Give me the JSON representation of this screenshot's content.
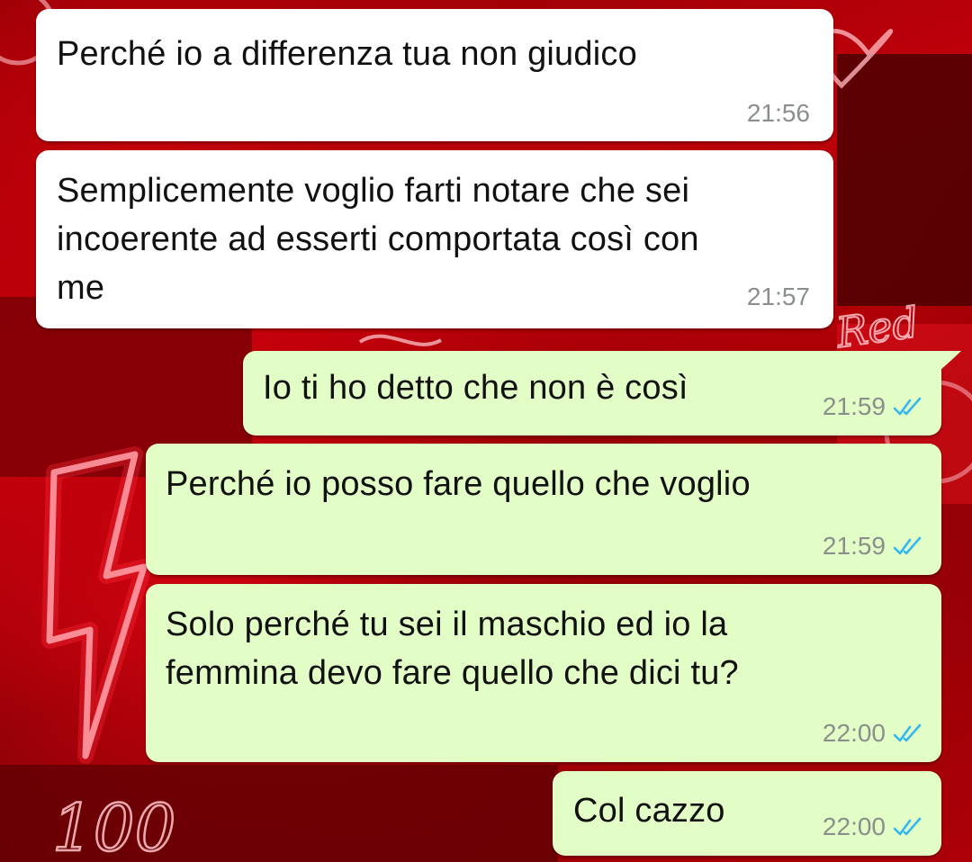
{
  "theme": {
    "incoming_bubble": "#ffffff",
    "outgoing_bubble": "#e2fdc6",
    "timestamp_color": "#8a8f8c",
    "read_ticks_color": "#34b7f1",
    "wallpaper_accent": "#d0020f"
  },
  "wallpaper": {
    "neon_text_1": "Red",
    "neon_text_2": "100"
  },
  "messages": [
    {
      "direction": "incoming",
      "text": "Perché io a differenza tua non giudico",
      "time": "21:56"
    },
    {
      "direction": "incoming",
      "text": "Semplicemente voglio farti notare che sei\nincoerente ad esserti comportata così con\nme",
      "time": "21:57"
    },
    {
      "direction": "outgoing",
      "text": "Io ti ho detto che non è così",
      "time": "21:59",
      "status": "read-double-check-icon"
    },
    {
      "direction": "outgoing",
      "text": "Perché io posso fare quello che voglio",
      "time": "21:59",
      "status": "read-double-check-icon"
    },
    {
      "direction": "outgoing",
      "text": "Solo perché tu sei il maschio ed io la\nfemmina devo fare quello che dici tu?",
      "time": "22:00",
      "status": "read-double-check-icon"
    },
    {
      "direction": "outgoing",
      "text": "Col cazzo",
      "time": "22:00",
      "status": "read-double-check-icon"
    }
  ]
}
